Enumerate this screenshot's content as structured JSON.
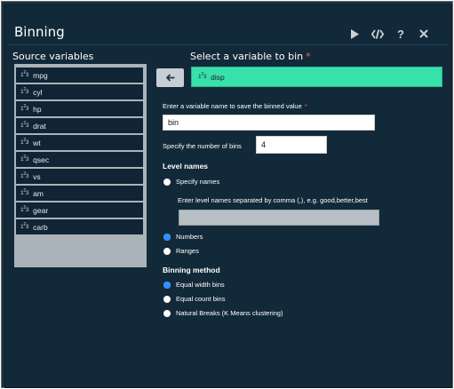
{
  "header": {
    "title": "Binning"
  },
  "toolbar": {
    "icons": [
      "play-icon",
      "code-icon",
      "help-icon",
      "close-icon"
    ],
    "help_glyph": "?"
  },
  "source": {
    "title": "Source variables",
    "items": [
      {
        "icon": "123",
        "label": "mpg"
      },
      {
        "icon": "123",
        "label": "cyl"
      },
      {
        "icon": "123",
        "label": "hp"
      },
      {
        "icon": "123",
        "label": "drat"
      },
      {
        "icon": "123",
        "label": "wt"
      },
      {
        "icon": "123",
        "label": "qsec"
      },
      {
        "icon": "123",
        "label": "vs"
      },
      {
        "icon": "123",
        "label": "am"
      },
      {
        "icon": "123",
        "label": "gear"
      },
      {
        "icon": "123",
        "label": "carb"
      }
    ]
  },
  "target": {
    "title": "Select a variable to bin",
    "required": "*",
    "value": "disp"
  },
  "save_name": {
    "label": "Enter a variable name to save the binned value",
    "required": "*",
    "value": "bin"
  },
  "num_bins": {
    "label": "Specify the number of bins",
    "value": "4"
  },
  "level_names": {
    "heading": "Level names",
    "specify_label": "Specify names",
    "hint": "Enter level names separated by comma (,), e.g. good,better,best",
    "input_value": "",
    "numbers_label": "Numbers",
    "ranges_label": "Ranges",
    "selected": "Numbers"
  },
  "method": {
    "heading": "Binning method",
    "options": [
      "Equal width bins",
      "Equal count bins",
      "Natural Breaks (K Means clustering)"
    ],
    "selected": "Equal width bins"
  },
  "colors": {
    "accent": "#38e0aa",
    "background": "#12293a",
    "radio": "#2a8cff"
  }
}
